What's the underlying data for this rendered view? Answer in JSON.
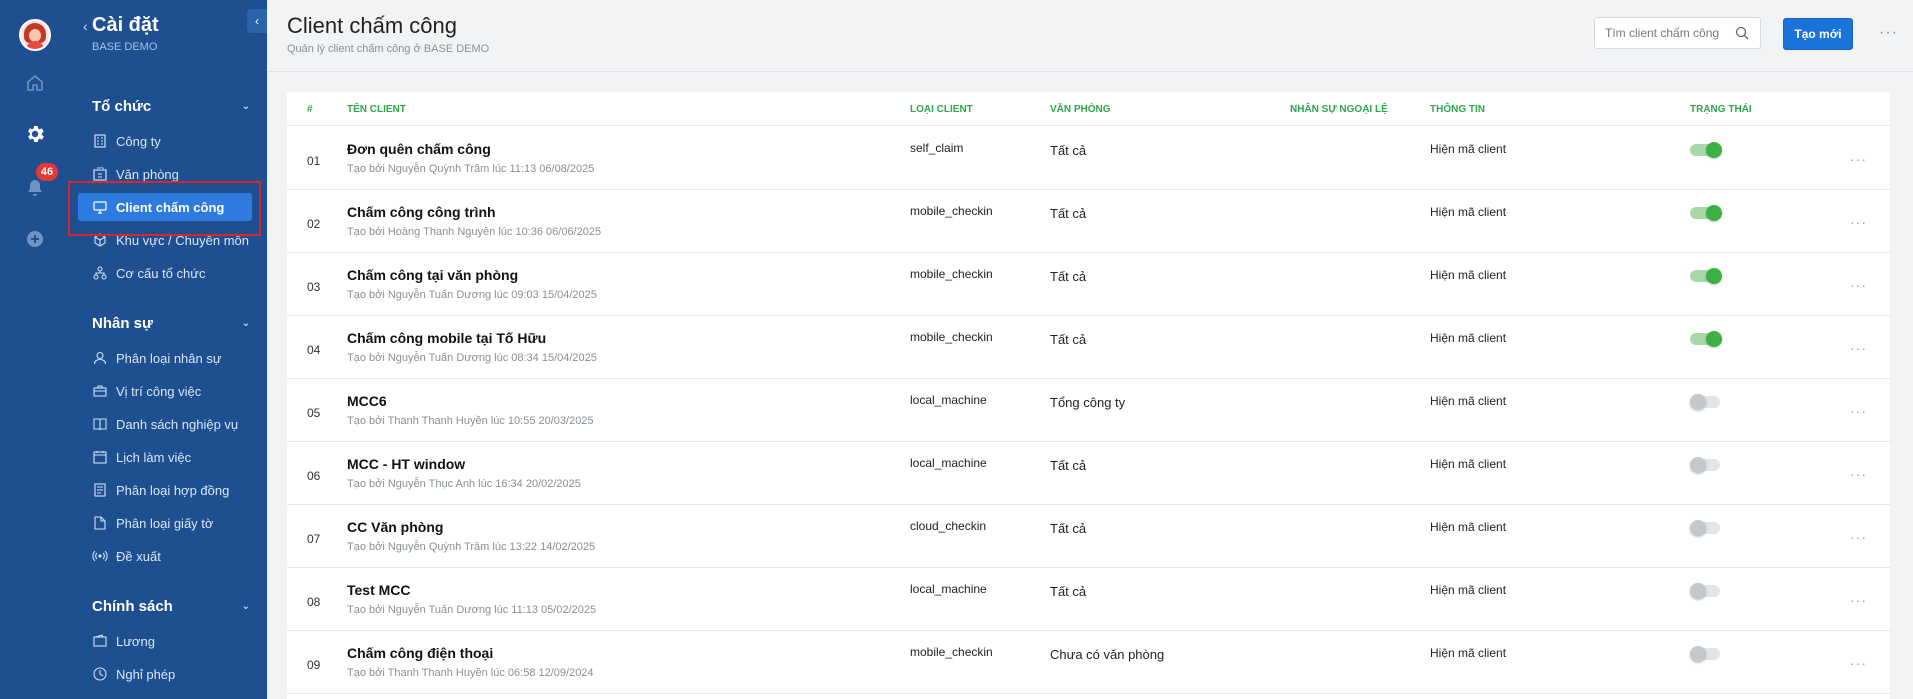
{
  "rail": {
    "notification_count": "46",
    "icons": [
      "avatar",
      "home-icon",
      "gear-icon",
      "bell-icon",
      "plus-circle-icon"
    ]
  },
  "sidebar": {
    "title": "Cài đặt",
    "subtitle": "BASE DEMO",
    "sections": [
      {
        "title": "Tổ chức",
        "items": [
          {
            "label": "Công ty",
            "icon": "building-icon"
          },
          {
            "label": "Văn phòng",
            "icon": "office-icon"
          },
          {
            "label": "Client chấm công",
            "icon": "monitor-icon",
            "active": true
          },
          {
            "label": "Khu vực / Chuyên môn",
            "icon": "cube-icon"
          },
          {
            "label": "Cơ cấu tổ chức",
            "icon": "org-chart-icon"
          }
        ]
      },
      {
        "title": "Nhân sự",
        "items": [
          {
            "label": "Phân loại nhân sự",
            "icon": "user-icon"
          },
          {
            "label": "Vị trí công việc",
            "icon": "briefcase-icon"
          },
          {
            "label": "Danh sách nghiệp vụ",
            "icon": "book-icon"
          },
          {
            "label": "Lịch làm việc",
            "icon": "calendar-icon"
          },
          {
            "label": "Phân loại hợp đồng",
            "icon": "contract-icon"
          },
          {
            "label": "Phân loại giấy tờ",
            "icon": "document-icon"
          },
          {
            "label": "Đề xuất",
            "icon": "broadcast-icon"
          }
        ]
      },
      {
        "title": "Chính sách",
        "items": [
          {
            "label": "Lương",
            "icon": "wallet-icon"
          },
          {
            "label": "Nghỉ phép",
            "icon": "clock-icon"
          }
        ]
      }
    ]
  },
  "header": {
    "title": "Client chấm công",
    "subtitle": "Quản lý client chấm công ở BASE DEMO",
    "search_placeholder": "Tìm client chấm công",
    "create_label": "Tạo mới",
    "more_label": "···"
  },
  "table": {
    "columns": [
      "#",
      "TÊN CLIENT",
      "LOẠI CLIENT",
      "VĂN PHÒNG",
      "NHÂN SỰ NGOẠI LỆ",
      "THÔNG TIN",
      "TRẠNG THÁI"
    ],
    "rows": [
      {
        "num": "01",
        "name": "Đơn quên chấm công",
        "meta": "Tạo bởi Nguyễn Quỳnh Trâm lúc 11:13 06/08/2025",
        "type": "self_claim",
        "office": "Tất cả",
        "info": "Hiện mã client",
        "enabled": true
      },
      {
        "num": "02",
        "name": "Chấm công công trình",
        "meta": "Tạo bởi Hoàng Thanh Nguyên lúc 10:36 06/06/2025",
        "type": "mobile_checkin",
        "office": "Tất cả",
        "info": "Hiện mã client",
        "enabled": true
      },
      {
        "num": "03",
        "name": "Chấm công tại văn phòng",
        "meta": "Tạo bởi Nguyễn Tuấn Dương lúc 09:03 15/04/2025",
        "type": "mobile_checkin",
        "office": "Tất cả",
        "info": "Hiện mã client",
        "enabled": true
      },
      {
        "num": "04",
        "name": "Chấm công mobile tại Tố Hữu",
        "meta": "Tạo bởi Nguyễn Tuấn Dương lúc 08:34 15/04/2025",
        "type": "mobile_checkin",
        "office": "Tất cả",
        "info": "Hiện mã client",
        "enabled": true
      },
      {
        "num": "05",
        "name": "MCC6",
        "meta": "Tạo bởi Thanh Thanh Huyền lúc 10:55 20/03/2025",
        "type": "local_machine",
        "office": "Tổng công ty",
        "info": "Hiện mã client",
        "enabled": false
      },
      {
        "num": "06",
        "name": "MCC - HT window",
        "meta": "Tạo bởi Nguyễn Thục Anh lúc 16:34 20/02/2025",
        "type": "local_machine",
        "office": "Tất cả",
        "info": "Hiện mã client",
        "enabled": false
      },
      {
        "num": "07",
        "name": "CC Văn phòng",
        "meta": "Tạo bởi Nguyễn Quỳnh Trâm lúc 13:22 14/02/2025",
        "type": "cloud_checkin",
        "office": "Tất cả",
        "info": "Hiện mã client",
        "enabled": false
      },
      {
        "num": "08",
        "name": "Test MCC",
        "meta": "Tạo bởi Nguyễn Tuấn Dương lúc 11:13 05/02/2025",
        "type": "local_machine",
        "office": "Tất cả",
        "info": "Hiện mã client",
        "enabled": false
      },
      {
        "num": "09",
        "name": "Chấm công điện thoại",
        "meta": "Tạo bởi Thanh Thanh Huyền lúc 06:58 12/09/2024",
        "type": "mobile_checkin",
        "office": "Chưa có văn phòng",
        "info": "Hiện mã client",
        "enabled": false
      }
    ]
  },
  "colors": {
    "sidebar_bg": "#1d4f91",
    "active_item": "#2e7be0",
    "header_green": "#2ea84a",
    "toggle_on": "#3cb043",
    "primary_button": "#1a73d9",
    "highlight_border": "#d9262c"
  }
}
